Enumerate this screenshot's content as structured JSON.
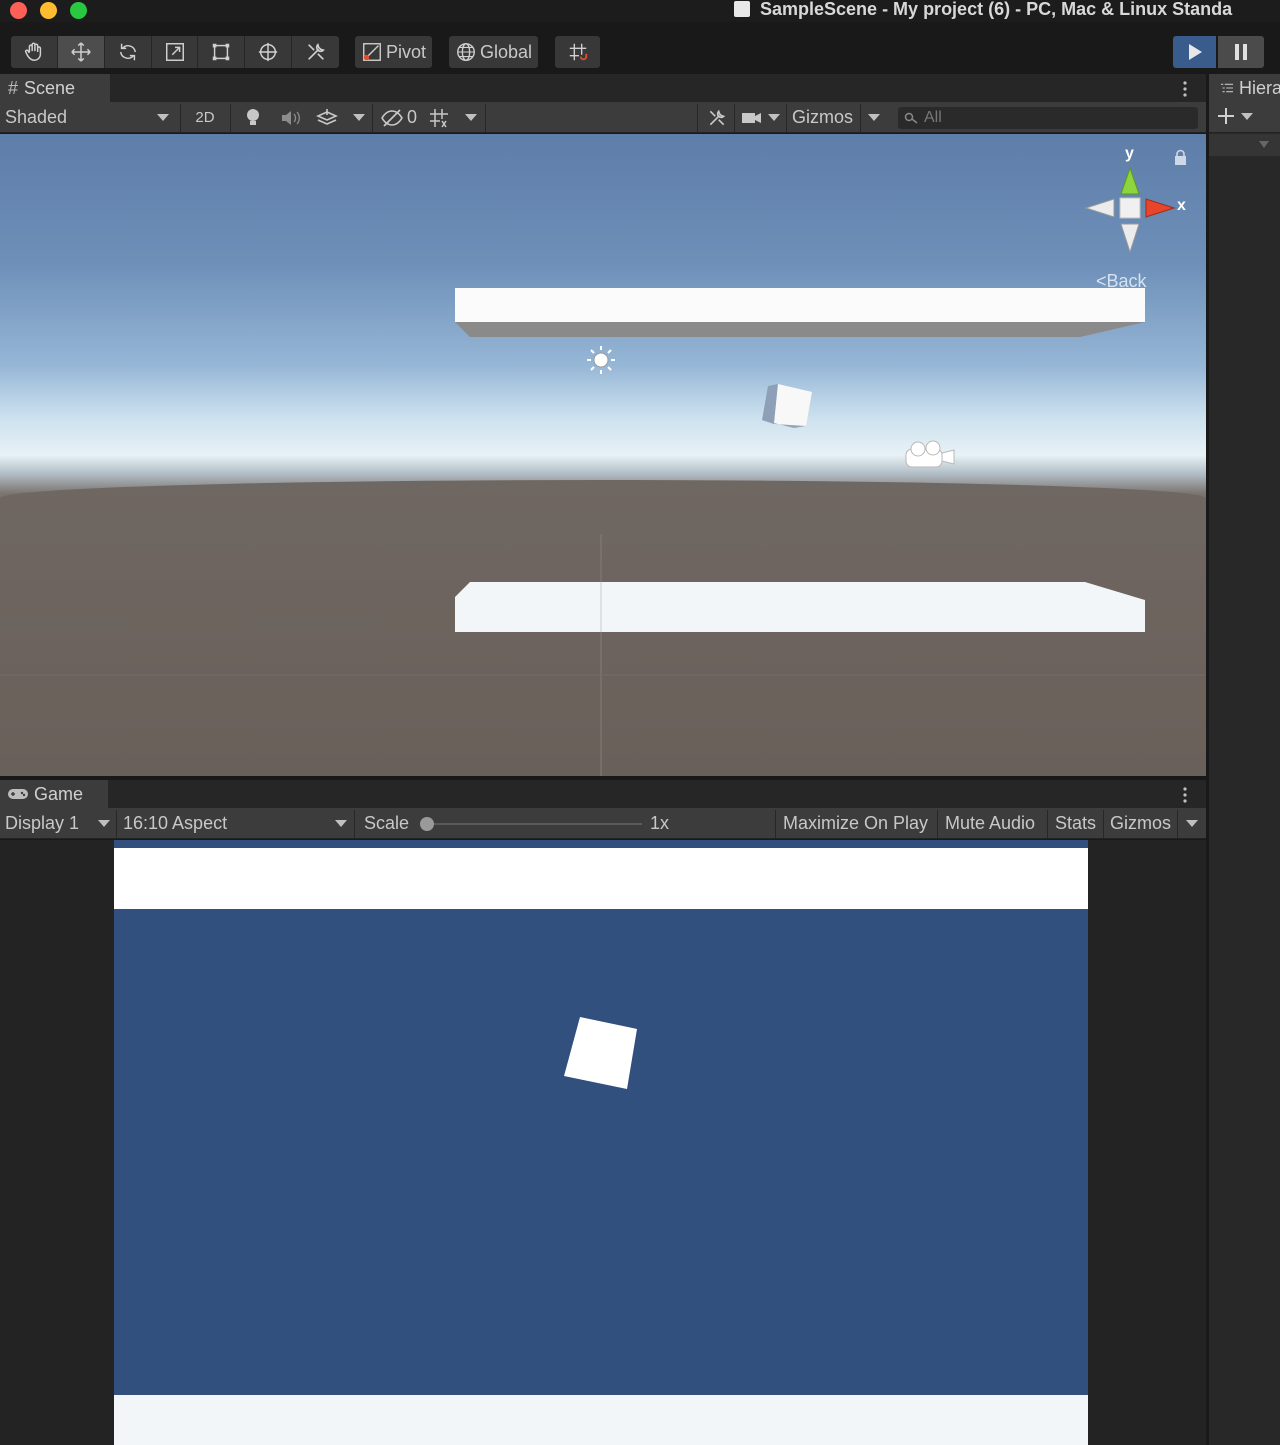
{
  "window": {
    "title": "SampleScene - My project (6) - PC, Mac & Linux Standa",
    "traffic_colors": {
      "close": "#fe5f57",
      "minimize": "#febc2e",
      "zoom": "#28c840"
    }
  },
  "toolbar": {
    "tools": [
      "hand",
      "move",
      "rotate",
      "scale",
      "rect",
      "transform",
      "custom"
    ],
    "active_tool": "move",
    "pivot_label": "Pivot",
    "global_label": "Global",
    "play_color": "#3a5c8c"
  },
  "scene": {
    "tab_label": "Scene",
    "shading_mode": "Shaded",
    "mode_2d_label": "2D",
    "hidden_count": "0",
    "gizmos_label": "Gizmos",
    "search_placeholder": "All",
    "orientation": {
      "y_label": "y",
      "x_label": "x",
      "view_label": "Back"
    }
  },
  "game": {
    "tab_label": "Game",
    "display": "Display 1",
    "aspect": "16:10 Aspect",
    "scale_label": "Scale",
    "scale_value": "1x",
    "maximize_label": "Maximize On Play",
    "mute_label": "Mute Audio",
    "stats_label": "Stats",
    "gizmos_label": "Gizmos",
    "background_color": "#31507d"
  },
  "hierarchy": {
    "tab_label": "Hiera"
  }
}
